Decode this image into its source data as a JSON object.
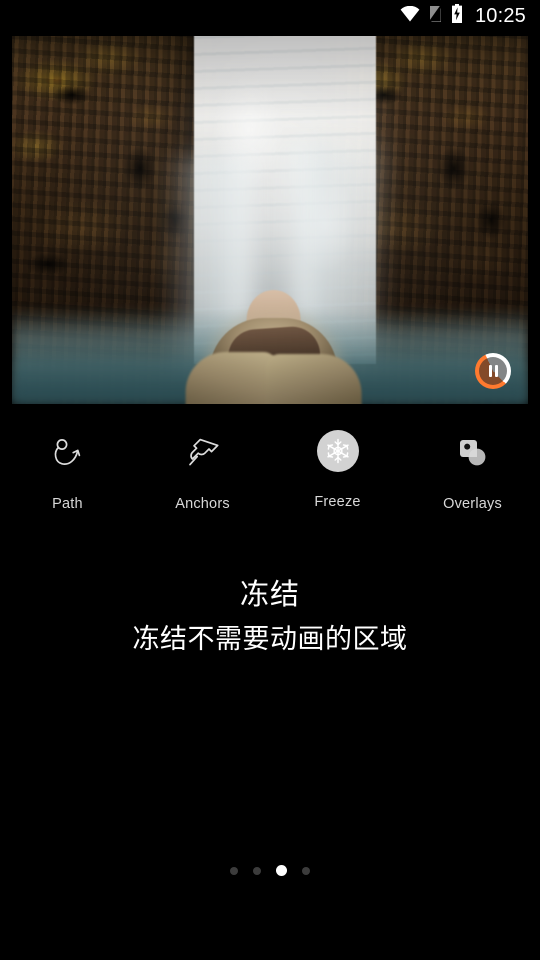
{
  "statusbar": {
    "time": "10:25",
    "icons": [
      {
        "name": "wifi-icon"
      },
      {
        "name": "no-sim-icon"
      },
      {
        "name": "battery-charging-icon"
      }
    ]
  },
  "video": {
    "scene_description": "Person in fur-hooded parka viewed from behind facing a tall waterfall between dark basalt cliffs",
    "player_button": {
      "name": "pause-button",
      "state": "playing",
      "progress_percent": 56
    },
    "accent_color": "#ff7a2f"
  },
  "tools": [
    {
      "label": "Path",
      "icon": "motion-path-icon",
      "active": false
    },
    {
      "label": "Anchors",
      "icon": "pushpin-icon",
      "active": false
    },
    {
      "label": "Freeze",
      "icon": "snowflake-icon",
      "active": true
    },
    {
      "label": "Overlays",
      "icon": "overlays-icon",
      "active": false
    }
  ],
  "caption": {
    "title": "冻结",
    "subtitle": "冻结不需要动画的区域"
  },
  "pager": {
    "count": 4,
    "active_index": 2,
    "active_color": "#ffffff",
    "inactive_color": "#3c3c3c"
  }
}
